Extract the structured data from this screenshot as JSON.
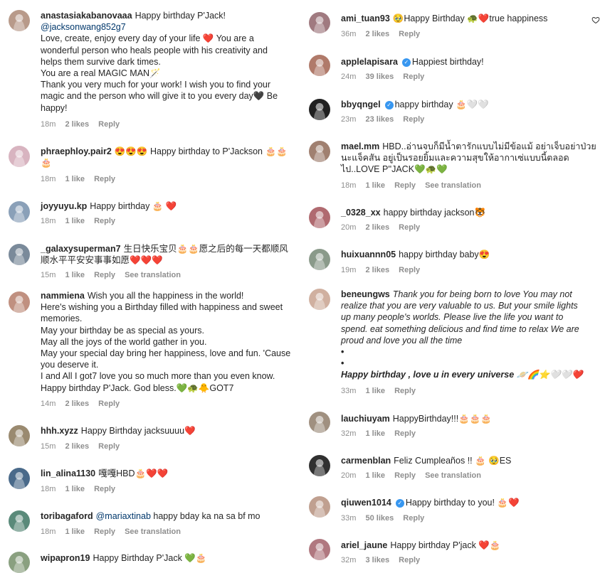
{
  "left": [
    {
      "user": "anastasiakabanovaaa",
      "mention": "@jacksonwang852g7",
      "text": "Happy birthday P'Jack!",
      "text2": "Love, create, enjoy every day of your life ❤️ You are a\nwonderful person who heals people with his creativity and\nhelps them survive dark times.\nYou are a real MAGIC MAN🪄\nThank you very much for your work! I wish you to find your\nmagic and the person who will give it to you every day🖤 Be\nhappy!",
      "time": "18m",
      "likes": "2 likes",
      "reply": "Reply",
      "avatar": "#b89a8a"
    },
    {
      "user": "phraephloy.pair2",
      "text": "😍😍😍 Happy birthday to P'Jackson 🎂🎂\n🎂",
      "time": "18m",
      "likes": "1 like",
      "reply": "Reply",
      "avatar": "#d8b4c0"
    },
    {
      "user": "joyyuyu.kp",
      "text": "Happy birthday 🎂 ❤️",
      "time": "18m",
      "likes": "1 like",
      "reply": "Reply",
      "avatar": "#8aa0b8"
    },
    {
      "user": "_galaxysuperman7",
      "text": "生日快乐宝贝🎂🎂愿之后的每一天都顺风\n顺水平平安安事事如愿❤️❤️❤️",
      "time": "15m",
      "likes": "1 like",
      "reply": "Reply",
      "translation": "See translation",
      "avatar": "#7a8a9a"
    },
    {
      "user": "nammiena",
      "text": "Wish you all the happiness in the world!\nHere's wishing you a Birthday filled with happiness and sweet\nmemories.\nMay your birthday be as special as yours.\nMay all the joys of the world gather in you.\nMay your special day bring her happiness, love and fun. 'Cause\nyou deserve it.\nI and All I got7 love you so much more than you even know.\nHappy birthday P'Jack. God bless.💚🐢🐥GOT7",
      "time": "14m",
      "likes": "2 likes",
      "reply": "Reply",
      "avatar": "#c09080"
    },
    {
      "user": "hhh.xyzz",
      "text": "Happy Birthday jacksuuuu❤️",
      "time": "15m",
      "likes": "2 likes",
      "reply": "Reply",
      "avatar": "#9a8a70"
    },
    {
      "user": "lin_alina1130",
      "text": "嘎嘎HBD🎂❤️❤️",
      "time": "18m",
      "likes": "1 like",
      "reply": "Reply",
      "avatar": "#4a6a8a"
    },
    {
      "user": "toribagaford",
      "mention": "@mariaxtinab",
      "text": "happy bday ka na sa bf mo",
      "time": "18m",
      "likes": "1 like",
      "reply": "Reply",
      "translation": "See translation",
      "avatar": "#5a8a7a"
    },
    {
      "user": "wipapron19",
      "text": "Happy Birthday P'Jack 💚🎂",
      "avatar": "#8aa080"
    }
  ],
  "right": [
    {
      "user": "ami_tuan93",
      "text": "🥹Happy Birthday 🐢❤️true happiness",
      "time": "36m",
      "likes": "2 likes",
      "reply": "Reply",
      "avatar": "#a07a80"
    },
    {
      "user": "applelapisara",
      "verified": true,
      "text": "Happiest birthday!",
      "time": "24m",
      "likes": "39 likes",
      "reply": "Reply",
      "avatar": "#b07a6a"
    },
    {
      "user": "bbyqngel",
      "verified": true,
      "text": "happy birthday 🎂🤍🤍",
      "time": "23m",
      "likes": "23 likes",
      "reply": "Reply",
      "avatar": "#202020"
    },
    {
      "user": "mael.mm",
      "text": "HBD..อ่านจบก็มีน้ำตารักแบบไม่มีข้อแม้ อย่าเจ็บอย่าป่วย\nนะแจ็คสัน อยู่เป็นรอยยิ้มและความสุขให้อากาเซ่แบบนี้ตลอด\nไป..LOVE P''JACK💚🐢💚",
      "time": "18m",
      "likes": "1 like",
      "reply": "Reply",
      "translation": "See translation",
      "avatar": "#a08070"
    },
    {
      "user": "_0328_xx",
      "text": "happy birthday jackson🐯",
      "time": "20m",
      "likes": "2 likes",
      "reply": "Reply",
      "avatar": "#b06a70"
    },
    {
      "user": "huixuannn05",
      "text": "happy birthday baby😍",
      "time": "19m",
      "likes": "2 likes",
      "reply": "Reply",
      "avatar": "#8a9a8a"
    },
    {
      "user": "beneungws",
      "text": "Thank you for being born to love You may not\nrealize that you are very valuable to us. But your smile lights\nup many people's worlds. Please live the life you want to\nspend. eat something delicious and find time to relax We are\nproud and love you all the time",
      "bullets": [
        "•",
        "•"
      ],
      "bold_line": "Happy birthday , love u in every universe 🪐🌈⭐🤍🤍❤️",
      "time": "33m",
      "likes": "1 like",
      "reply": "Reply",
      "avatar": "#d0b0a0"
    },
    {
      "user": "lauchiuyam",
      "text": "HappyBirthday!!!🎂🎂🎂",
      "time": "32m",
      "likes": "1 like",
      "reply": "Reply",
      "avatar": "#a09080"
    },
    {
      "user": "carmenblan",
      "text": "Feliz Cumpleaños !! 🎂 🥹ES",
      "time": "20m",
      "likes": "1 like",
      "reply": "Reply",
      "translation": "See translation",
      "avatar": "#303030"
    },
    {
      "user": "qiuwen1014",
      "verified": true,
      "text": "Happy birthday to you! 🎂❤️",
      "time": "33m",
      "likes": "50 likes",
      "reply": "Reply",
      "avatar": "#c0a090"
    },
    {
      "user": "ariel_jaune",
      "text": "Happy birthday P'jack ❤️🎂",
      "time": "32m",
      "likes": "3 likes",
      "reply": "Reply",
      "avatar": "#b07880"
    }
  ]
}
